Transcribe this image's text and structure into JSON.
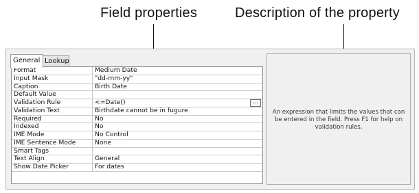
{
  "callouts": {
    "left": "Field properties",
    "right": "Description of the property"
  },
  "tabs": [
    {
      "label": "General",
      "active": true
    },
    {
      "label": "Lookup",
      "active": false
    }
  ],
  "properties": [
    {
      "name": "Format",
      "value": "Medium Date"
    },
    {
      "name": "Input Mask",
      "value": "\"dd-mm-yy\""
    },
    {
      "name": "Caption",
      "value": "Birth Date"
    },
    {
      "name": "Default Value",
      "value": ""
    },
    {
      "name": "Validation Rule",
      "value": "<=Date()"
    },
    {
      "name": "Validation Text",
      "value": "Birthdate cannot be in fugure"
    },
    {
      "name": "Required",
      "value": "No"
    },
    {
      "name": "Indexed",
      "value": "No"
    },
    {
      "name": "IME Mode",
      "value": "No Control"
    },
    {
      "name": "IME Sentence Mode",
      "value": "None"
    },
    {
      "name": "Smart Tags",
      "value": ""
    },
    {
      "name": "Text Align",
      "value": "General"
    },
    {
      "name": "Show Date Picker",
      "value": "For dates"
    }
  ],
  "builder_button": {
    "label": "..."
  },
  "description": "An expression that limits the values that can be entered in the field. Press F1 for help on validation rules."
}
